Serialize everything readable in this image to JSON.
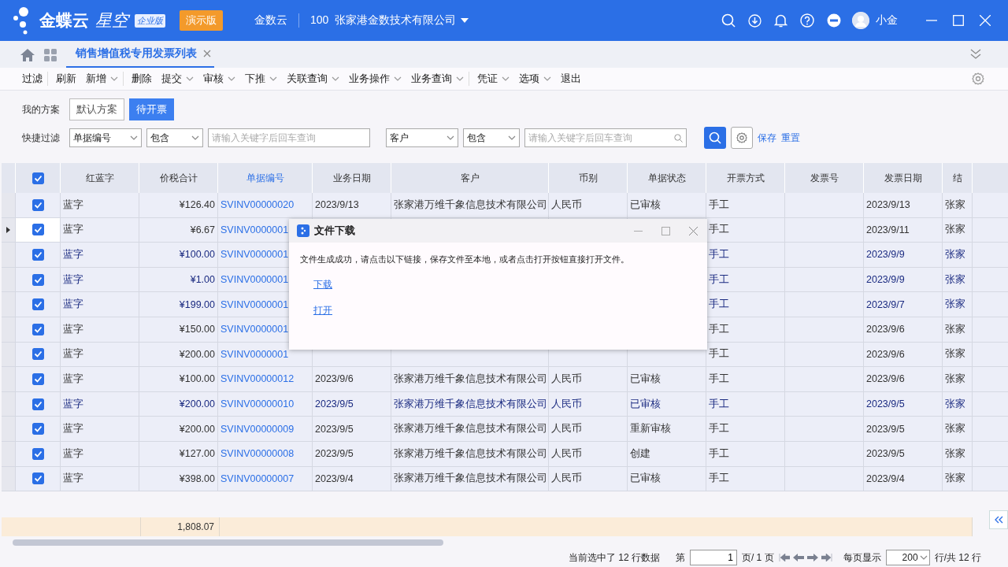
{
  "header": {
    "brand": "金蝶云",
    "product": "星空",
    "edition": "企业版",
    "demo_badge": "演示版",
    "tenant": "金数云",
    "org_code": "100",
    "org_name": "张家港金数技术有限公司",
    "user": "小金"
  },
  "tabs": [
    {
      "label": "销售增值税专用发票列表",
      "selected": true
    }
  ],
  "toolbar": [
    {
      "label": "过滤",
      "dropdown": false,
      "divider": true
    },
    {
      "label": "刷新",
      "dropdown": false,
      "divider": false
    },
    {
      "label": "新增",
      "dropdown": true,
      "divider": true
    },
    {
      "label": "删除",
      "dropdown": false,
      "divider": false
    },
    {
      "label": "提交",
      "dropdown": true,
      "divider": false
    },
    {
      "label": "审核",
      "dropdown": true,
      "divider": false
    },
    {
      "label": "下推",
      "dropdown": true,
      "divider": false
    },
    {
      "label": "关联查询",
      "dropdown": true,
      "divider": false
    },
    {
      "label": "业务操作",
      "dropdown": true,
      "divider": false
    },
    {
      "label": "业务查询",
      "dropdown": true,
      "divider": true
    },
    {
      "label": "凭证",
      "dropdown": true,
      "divider": false
    },
    {
      "label": "选项",
      "dropdown": true,
      "divider": false
    },
    {
      "label": "退出",
      "dropdown": false,
      "divider": false
    }
  ],
  "schemes": {
    "label": "我的方案",
    "items": [
      {
        "label": "默认方案",
        "selected": false
      },
      {
        "label": "待开票",
        "selected": true
      }
    ]
  },
  "quick_filter": {
    "label": "快捷过滤",
    "field1": "单据编号",
    "op1": "包含",
    "placeholder1": "请输入关键字后回车查询",
    "field2": "客户",
    "op2": "包含",
    "placeholder2": "请输入关键字后回车查询",
    "save": "保存",
    "reset": "重置"
  },
  "table": {
    "all_checked": true,
    "columns": [
      {
        "label": "红蓝字",
        "active": false
      },
      {
        "label": "价税合计",
        "active": false
      },
      {
        "label": "单据编号",
        "active": true
      },
      {
        "label": "业务日期",
        "active": false
      },
      {
        "label": "客户",
        "active": false
      },
      {
        "label": "币别",
        "active": false
      },
      {
        "label": "单据状态",
        "active": false
      },
      {
        "label": "开票方式",
        "active": false
      },
      {
        "label": "发票号",
        "active": false
      },
      {
        "label": "发票日期",
        "active": false
      },
      {
        "label": "结",
        "active": false
      }
    ],
    "rows": [
      {
        "current": false,
        "checked": true,
        "highlighted": false,
        "cells": [
          "蓝字",
          "¥126.40",
          "SVINV00000020",
          "2023/9/13",
          "张家港万维千象信息技术有限公司",
          "人民币",
          "已审核",
          "手工",
          null,
          "2023/9/13",
          "张家"
        ]
      },
      {
        "current": true,
        "checked": true,
        "highlighted": false,
        "cells": [
          "蓝字",
          "¥6.67",
          "SVINV0000001",
          null,
          null,
          null,
          null,
          "手工",
          null,
          "2023/9/11",
          "张家"
        ]
      },
      {
        "current": false,
        "checked": true,
        "highlighted": true,
        "cells": [
          "蓝字",
          "¥100.00",
          "SVINV0000001",
          null,
          null,
          null,
          null,
          "手工",
          null,
          "2023/9/9",
          "张家"
        ]
      },
      {
        "current": false,
        "checked": true,
        "highlighted": true,
        "cells": [
          "蓝字",
          "¥1.00",
          "SVINV0000001",
          null,
          null,
          null,
          null,
          "手工",
          null,
          "2023/9/9",
          "张家"
        ]
      },
      {
        "current": false,
        "checked": true,
        "highlighted": true,
        "cells": [
          "蓝字",
          "¥199.00",
          "SVINV0000001",
          null,
          null,
          null,
          null,
          "手工",
          null,
          "2023/9/7",
          "张家"
        ]
      },
      {
        "current": false,
        "checked": true,
        "highlighted": false,
        "cells": [
          "蓝字",
          "¥150.00",
          "SVINV0000001",
          null,
          null,
          null,
          null,
          "手工",
          null,
          "2023/9/6",
          "张家"
        ]
      },
      {
        "current": false,
        "checked": true,
        "highlighted": false,
        "cells": [
          "蓝字",
          "¥200.00",
          "SVINV0000001",
          null,
          null,
          null,
          null,
          "手工",
          null,
          "2023/9/6",
          "张家"
        ]
      },
      {
        "current": false,
        "checked": true,
        "highlighted": false,
        "cells": [
          "蓝字",
          "¥100.00",
          "SVINV00000012",
          "2023/9/6",
          "张家港万维千象信息技术有限公司",
          "人民币",
          "已审核",
          "手工",
          null,
          "2023/9/6",
          "张家"
        ]
      },
      {
        "current": false,
        "checked": true,
        "highlighted": true,
        "cells": [
          "蓝字",
          "¥200.00",
          "SVINV00000010",
          "2023/9/5",
          "张家港万维千象信息技术有限公司",
          "人民币",
          "已审核",
          "手工",
          null,
          "2023/9/5",
          "张家"
        ]
      },
      {
        "current": false,
        "checked": true,
        "highlighted": false,
        "cells": [
          "蓝字",
          "¥200.00",
          "SVINV00000009",
          "2023/9/5",
          "张家港万维千象信息技术有限公司",
          "人民币",
          "重新审核",
          "手工",
          null,
          "2023/9/5",
          "张家"
        ]
      },
      {
        "current": false,
        "checked": true,
        "highlighted": false,
        "cells": [
          "蓝字",
          "¥127.00",
          "SVINV00000008",
          "2023/9/5",
          "张家港万维千象信息技术有限公司",
          "人民币",
          "创建",
          "手工",
          null,
          "2023/9/5",
          "张家"
        ]
      },
      {
        "current": false,
        "checked": true,
        "highlighted": false,
        "cells": [
          "蓝字",
          "¥398.00",
          "SVINV00000007",
          "2023/9/4",
          "张家港万维千象信息技术有限公司",
          "人民币",
          "已审核",
          "手工",
          null,
          "2023/9/4",
          "张家"
        ]
      }
    ],
    "total": "1,808.07"
  },
  "dialog": {
    "title": "文件下载",
    "message": "文件生成成功，请点击以下链接，保存文件至本地，或者点击打开按钮直接打开文件。",
    "links": [
      "下载",
      "打开"
    ]
  },
  "status_bar": {
    "selection": "当前选中了 12 行数据",
    "page_prefix": "第",
    "page": "1",
    "page_suffix": "页/ 1 页",
    "per_page_label": "每页显示",
    "per_page": "200",
    "rows_total": "行/共 12 行"
  }
}
